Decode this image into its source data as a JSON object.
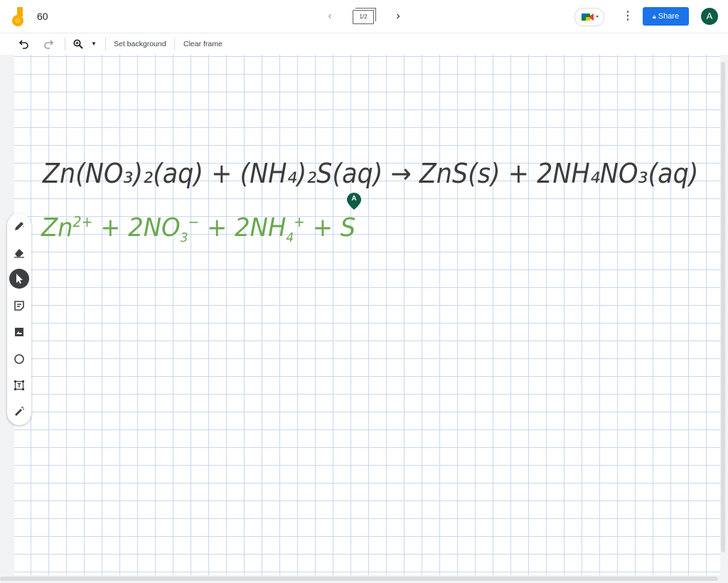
{
  "app": {
    "title": "60",
    "frame_indicator": "1/2",
    "share_label": "Share",
    "avatar_letter": "A",
    "brand_color": "#f9ab00",
    "accent_color": "#1a73e8",
    "avatar_color": "#0d5c46"
  },
  "toolbar": {
    "undo_icon": "undo-icon",
    "redo_icon": "redo-icon",
    "zoom_icon": "zoom-in-icon",
    "set_background_label": "Set background",
    "clear_frame_label": "Clear frame"
  },
  "tools": [
    "pen-icon",
    "eraser-icon",
    "select-icon",
    "sticky-note-icon",
    "image-icon",
    "circle-icon",
    "text-box-icon",
    "laser-icon"
  ],
  "canvas": {
    "equation_line1": "Zn(NO₃)₂(aq) + (NH₄)₂S(aq) → ZnS(s) + 2NH₄NO₃(aq)",
    "equation_line2_parts": [
      "Zn",
      "2+",
      " + 2NO",
      "3",
      "−",
      " + 2NH",
      "4",
      "+",
      " + S"
    ],
    "ink_color_line1": "#3c3c3c",
    "ink_color_line2": "#6aa84f",
    "collaborator_cursor": "A"
  }
}
